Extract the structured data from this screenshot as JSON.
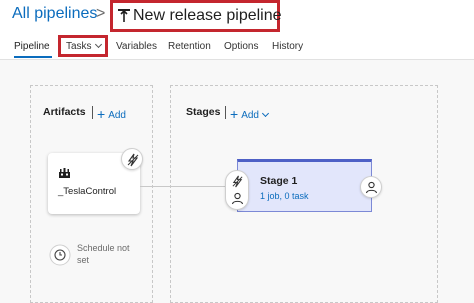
{
  "header": {
    "breadcrumb": "All pipelines",
    "separator": ">",
    "title": "New release pipeline"
  },
  "tabs": [
    {
      "label": "Pipeline",
      "active": true
    },
    {
      "label": "Tasks",
      "has_dropdown": true
    },
    {
      "label": "Variables"
    },
    {
      "label": "Retention"
    },
    {
      "label": "Options"
    },
    {
      "label": "History"
    }
  ],
  "artifacts": {
    "heading": "Artifacts",
    "add_label": "Add",
    "artifact_name": "_TeslaControl",
    "schedule_text": "Schedule not set"
  },
  "stages": {
    "heading": "Stages",
    "add_label": "Add",
    "items": [
      {
        "name": "Stage 1",
        "summary": "1 job, 0 task"
      }
    ]
  },
  "icons": {
    "title": "pipeline-release-icon",
    "artifact": "build-artifact-icon",
    "trigger": "lightning-trigger-icon",
    "approver": "person-icon",
    "schedule": "clock-icon"
  },
  "colors": {
    "accent": "#0b6cbd",
    "highlight_box": "#c4262e",
    "stage_fill": "#e2e6fb",
    "stage_border": "#4e60c6"
  }
}
